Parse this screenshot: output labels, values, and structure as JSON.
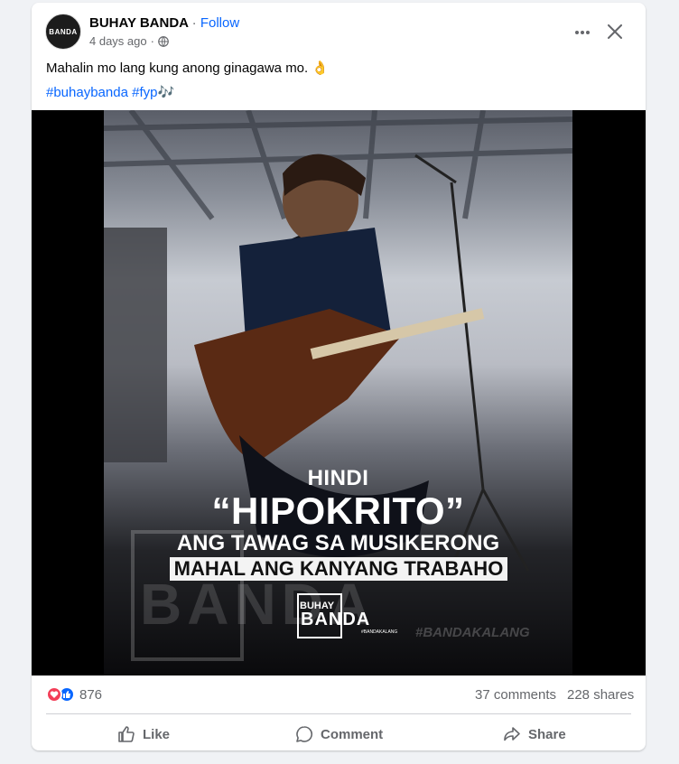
{
  "post": {
    "page_name": "BUHAY BANDA",
    "separator": "·",
    "follow_label": "Follow",
    "timestamp": "4 days ago",
    "timestamp_sep": "·",
    "avatar_text": "BANDA",
    "caption": "Mahalin mo lang kung anong ginagawa mo. 👌",
    "hashtags": [
      "#buhaybanda",
      "#fyp",
      "🎶"
    ]
  },
  "image": {
    "line1": "HINDI",
    "line2": "“HIPOKRITO”",
    "line3": "ANG TAWAG SA MUSIKERONG",
    "line4": "MAHAL ANG KANYANG TRABAHO",
    "watermark_big": "BANDA",
    "watermark_tag": "#BANDAKALANG",
    "logo_top": "BUHAY",
    "logo_main": "BANDA",
    "logo_sub": "#BANDAKALANG"
  },
  "stats": {
    "reactions_count": "876",
    "comments": "37 comments",
    "shares": "228 shares"
  },
  "actions": {
    "like": "Like",
    "comment": "Comment",
    "share": "Share"
  },
  "icons": {
    "more": "more-icon",
    "close": "close-icon",
    "globe": "globe-icon",
    "love": "love-reaction-icon",
    "like": "like-reaction-icon",
    "like_action": "thumbs-up-icon",
    "comment_action": "comment-icon",
    "share_action": "share-icon"
  },
  "colors": {
    "link": "#0866ff",
    "secondary_text": "#65676b",
    "love": "#f33e58",
    "like": "#0866ff"
  }
}
